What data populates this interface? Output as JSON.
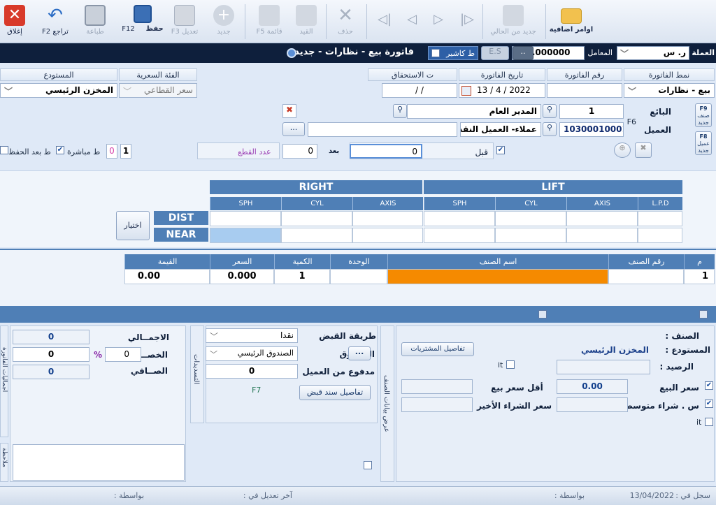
{
  "toolbar": {
    "close": "إغلاق",
    "undo": "تراجع F2",
    "print": "طباعة",
    "save": "حفظ",
    "save_key": "F12",
    "edit": "تعديل",
    "edit_key": "F3",
    "new": "جديد",
    "list": "قائمة F5",
    "entry": "القيد",
    "delete": "حذف",
    "new_from_current": "جديد من الحالي",
    "extra": "اوامر اضافية"
  },
  "titlebar": {
    "currency_label": "العملة",
    "currency_value": "ر. س",
    "rate_label": "المعامل",
    "rate_value": "1.000000",
    "dots": "..",
    "es": "E.S",
    "cashier": "ط كاشير",
    "title": "فاتورة بيع - نظارات - جديد"
  },
  "header": {
    "invoice_type_label": "نمط الفاتورة",
    "invoice_type": "بيع - نظارات",
    "invoice_no_label": "رقم الفاتورة",
    "invoice_date_label": "تاريخ الفاتورة",
    "invoice_date": "13 / 4 / 2022",
    "due_label": "ت الاستحقاق",
    "due_date": "/    /",
    "price_cat_label": "الفئة السعرية",
    "price_cat": "سعر القطاعي",
    "warehouse_label": "المستودع",
    "warehouse": "المخزن الرئيسي"
  },
  "parties": {
    "seller_label": "البائع",
    "seller_no": "1",
    "seller_name": "المدير العام",
    "customer_label": "العميل",
    "customer_no": "10300010001",
    "customer_name": "عملاء- العميل النقدي",
    "f6": "F6",
    "f9": "F9",
    "f9_sub": "صنف جديد",
    "f8": "F8",
    "f8_sub": "عميل جديد",
    "before_label": "قبل",
    "before_value": "0",
    "after_label": "بعد",
    "after_value": "0",
    "pieces_label": "عدد القطع",
    "direct_label": "ط مباشرة",
    "after_save_label": "ط بعد الحفظ",
    "print_count": "1",
    "print_zero": "0",
    "ellipsis": "..."
  },
  "lens": {
    "right": "RIGHT",
    "lift": "LIFT",
    "cols": [
      "SPH",
      "CYL",
      "AXIS",
      "SPH",
      "CYL",
      "AXIS",
      "L.P.D"
    ],
    "dist": "DIST",
    "near": "NEAR",
    "choose": "اختيار"
  },
  "grid": {
    "headers": [
      "م",
      "رقم الصنف",
      "اسم الصنف",
      "الوحدة",
      "الكمية",
      "السعر",
      "القيمة"
    ],
    "row": {
      "idx": "1",
      "item_no": "",
      "item_name": "",
      "unit": "",
      "qty": "1",
      "price": "0.000",
      "value": "0.00"
    }
  },
  "itempanel": {
    "item_label": "الصنف :",
    "warehouse_label": "المستودع :",
    "warehouse": "المخزن الرئيسي",
    "balance_label": "الرصيد :",
    "purchases_btn": "تفاصيل المشتريات",
    "it": "it",
    "sale_price_label": "سعر البيع",
    "sale_price": "0.00",
    "min_price_label": "أقل سعر بيع",
    "avg_cost_label": "س . شراء متوسط",
    "last_cost_label": "سعر الشراء الأخير",
    "side_label": "عرض بيانات الصنف"
  },
  "payment": {
    "method_label": "طريقة القبض",
    "method": "نقدا",
    "box_label": "الصندوق",
    "box": "الصندوق الرئيسي",
    "paid_label": "مدفوع من العميل",
    "paid": "0",
    "f7": "F7",
    "receipt_btn": "تفاصيل سند قبض",
    "side_label": "التسديدات"
  },
  "totals": {
    "total_label": "الاجمــالي",
    "total": "0",
    "discount_label": "الخصــم",
    "discount_pct": "0",
    "discount": "0",
    "pct": "%",
    "net_label": "الصــافي",
    "net": "0",
    "extra_label": "اجماليات الفاتورة",
    "note_label": "ملاحظة"
  },
  "statusbar": {
    "created": "سجل في :",
    "created_date": "13/04/2022",
    "by": "بواسطة :",
    "modified": "آخر تعديل في :",
    "by2": "بواسطة :"
  },
  "colors": {
    "accent": "#4f7fb6",
    "item_name_fill": "#f58a00",
    "titlebar": "#0e1f3c"
  }
}
